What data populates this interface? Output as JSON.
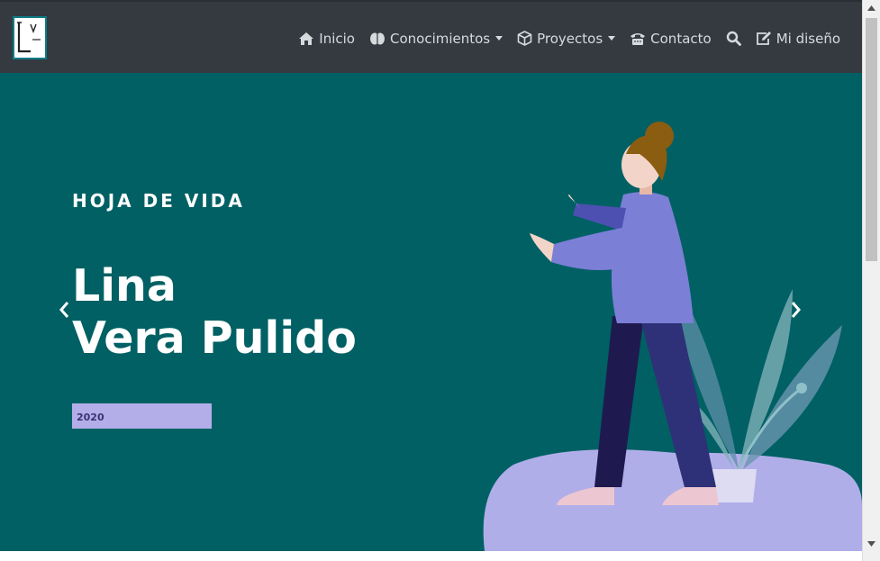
{
  "navbar": {
    "logo_alt": "LV logo",
    "items": [
      {
        "label": "Inicio",
        "icon": "home-icon"
      },
      {
        "label": "Conocimientos",
        "icon": "brain-icon",
        "dropdown": true
      },
      {
        "label": "Proyectos",
        "icon": "cube-icon",
        "dropdown": true
      },
      {
        "label": "Contacto",
        "icon": "phone-icon"
      },
      {
        "label": "",
        "icon": "search-icon"
      },
      {
        "label": "Mi diseño",
        "icon": "edit-icon"
      }
    ]
  },
  "hero": {
    "eyebrow": "HOJA DE VIDA",
    "name_line1": "Lina",
    "name_line2": "Vera Pulido",
    "year": "2020",
    "prev_icon": "chevron-left-icon",
    "next_icon": "chevron-right-icon"
  },
  "colors": {
    "navbar_bg": "#343a40",
    "hero_bg": "#006064",
    "badge_bg": "#b4aee8",
    "accent_purple": "#7b7fd6"
  }
}
